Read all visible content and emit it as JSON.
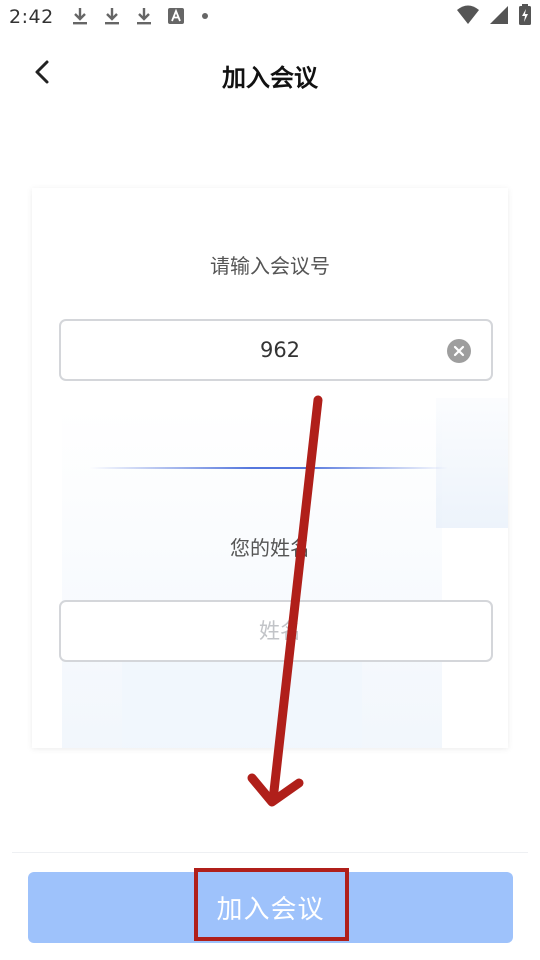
{
  "status_bar": {
    "time": "2:42",
    "left_icons": [
      "download-icon",
      "download-icon",
      "download-icon",
      "text-a-icon",
      "dot-icon"
    ],
    "right_icons": [
      "wifi-icon",
      "cell-signal-icon",
      "battery-charging-icon"
    ]
  },
  "header": {
    "title": "加入会议",
    "back_icon": "chevron-left-icon"
  },
  "form": {
    "meeting_label": "请输入会议号",
    "meeting_value": "962",
    "name_label": "您的姓名",
    "name_placeholder": "姓名",
    "name_value": ""
  },
  "footer": {
    "join_button_label": "加入会议"
  },
  "colors": {
    "button_bg": "#9ec2fb",
    "annotation_red": "#b01f1a",
    "divider_blue": "#5577dd"
  }
}
